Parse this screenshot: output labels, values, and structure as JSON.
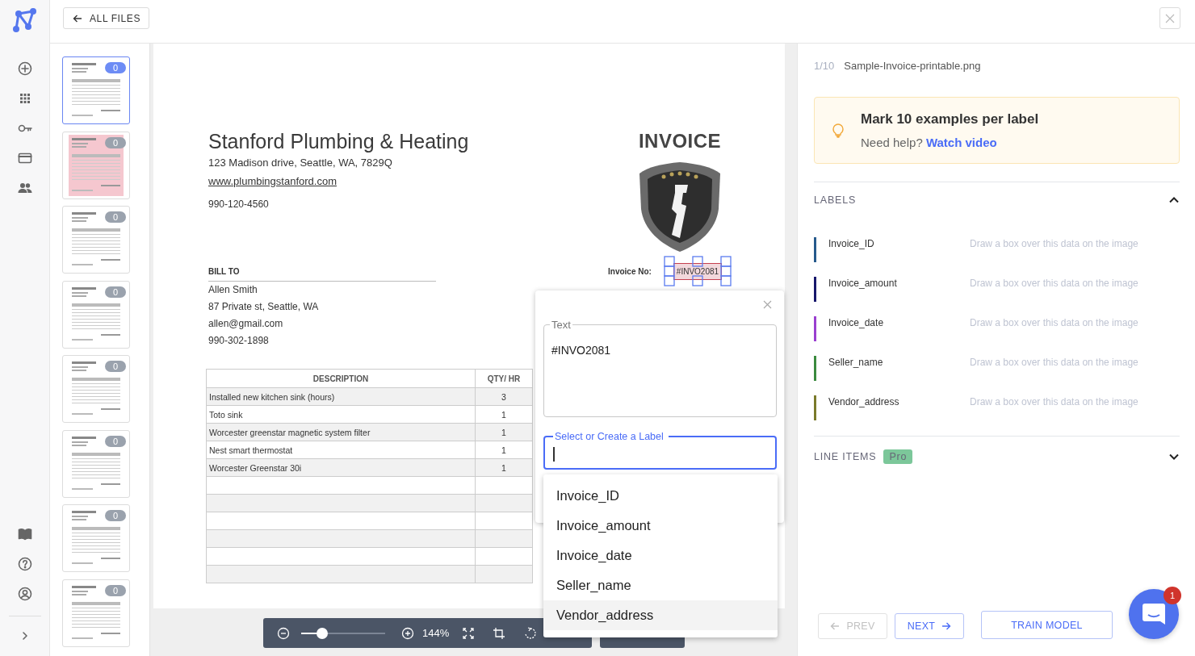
{
  "top_bar": {
    "back_button": "ALL FILES"
  },
  "thumbnails": [
    {
      "badge": "0",
      "selected": true,
      "kind": "white"
    },
    {
      "badge": "0",
      "selected": false,
      "kind": "pink"
    },
    {
      "badge": "0",
      "selected": false,
      "kind": "white"
    },
    {
      "badge": "0",
      "selected": false,
      "kind": "white"
    },
    {
      "badge": "0",
      "selected": false,
      "kind": "white"
    },
    {
      "badge": "0",
      "selected": false,
      "kind": "white"
    },
    {
      "badge": "0",
      "selected": false,
      "kind": "white"
    },
    {
      "badge": "0",
      "selected": false,
      "kind": "white"
    }
  ],
  "document": {
    "company": "Stanford Plumbing & Heating",
    "address": "123 Madison drive, Seattle, WA, 7829Q",
    "website": "www.plumbingstanford.com",
    "phone": "990-120-4560",
    "bill_to_heading": "BILL TO",
    "bill_to_lines": [
      "Allen Smith",
      "87 Private st, Seattle, WA",
      "allen@gmail.com",
      "990-302-1898"
    ],
    "title": "INVOICE",
    "invoice_no_label": "Invoice No:",
    "invoice_no_value": "#INVO2081",
    "table": {
      "columns": [
        "DESCRIPTION",
        "QTY/ HR"
      ],
      "rows": [
        [
          "Installed new kitchen sink (hours)",
          "3"
        ],
        [
          "Toto sink",
          "1"
        ],
        [
          "Worcester greenstar magnetic system filter",
          "1"
        ],
        [
          "Nest smart thermostat",
          "1"
        ],
        [
          "Worcester Greenstar 30i",
          "1"
        ]
      ]
    }
  },
  "zoom_bar": {
    "level": 0.25,
    "reading": "144%"
  },
  "popup": {
    "text_legend": "Text",
    "text_value": "#INVO2081",
    "label_field": {
      "label": "Select or Create a Label",
      "focused": true
    },
    "options": [
      {
        "label": "Invoice_ID",
        "selected": false
      },
      {
        "label": "Invoice_amount",
        "selected": false
      },
      {
        "label": "Invoice_date",
        "selected": false
      },
      {
        "label": "Seller_name",
        "selected": false
      },
      {
        "label": "Vendor_address",
        "selected": true
      }
    ]
  },
  "file_header": {
    "index": "1/10",
    "name": "Sample-Invoice-printable.png"
  },
  "tip": {
    "title": "Mark 10 examples per label",
    "text": "Need help?",
    "link": "Watch video"
  },
  "labels": {
    "heading": "LABELS",
    "expanded": true,
    "items": [
      {
        "name": "Invoice_ID",
        "hint": "Draw a box over this data on the image",
        "color": "#265a8c"
      },
      {
        "name": "Invoice_amount",
        "hint": "Draw a box over this data on the image",
        "color": "#17176b"
      },
      {
        "name": "Invoice_date",
        "hint": "Draw a box over this data on the image",
        "color": "#9a3fd0"
      },
      {
        "name": "Seller_name",
        "hint": "Draw a box over this data on the image",
        "color": "#3a8a3e"
      },
      {
        "name": "Vendor_address",
        "hint": "Draw a box over this data on the image",
        "color": "#7a7a2a"
      }
    ]
  },
  "line_items": {
    "heading": "LINE ITEMS",
    "badge": "Pro",
    "expanded": false
  },
  "nav": {
    "prev": {
      "label": "PREV",
      "disabled": true
    },
    "next": {
      "label": "NEXT",
      "disabled": false
    },
    "train": "TRAIN MODEL"
  },
  "chat": {
    "badge": "1"
  }
}
